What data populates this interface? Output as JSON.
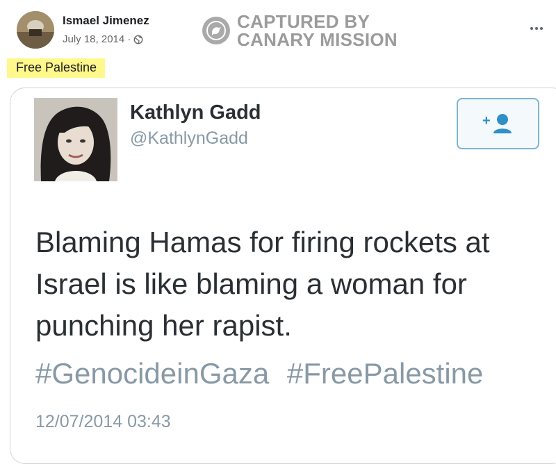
{
  "post": {
    "author": "Ismael Jimenez",
    "date": "July 18, 2014 ·",
    "audience_icon": "globe-icon",
    "text": "Free Palestine",
    "more_icon": "more-options-icon"
  },
  "watermark": {
    "line1": "CAPTURED BY",
    "line2": "CANARY MISSION",
    "icon": "canary-bird-icon"
  },
  "tweet": {
    "name": "Kathlyn Gadd",
    "handle": "@KathlynGadd",
    "follow_icon": "add-user-icon",
    "text": "Blaming Hamas for firing rockets at Israel is like blaming a woman for punching her rapist.",
    "hashtags": [
      "#GenocideinGaza",
      "#FreePalestine"
    ],
    "timestamp": "12/07/2014 03:43"
  },
  "colors": {
    "highlight": "#fff88a",
    "watermark": "#9b9b9b",
    "tweet_text": "#292f33",
    "tweet_muted": "#8899a6",
    "follow_border": "#7fb3d1"
  }
}
